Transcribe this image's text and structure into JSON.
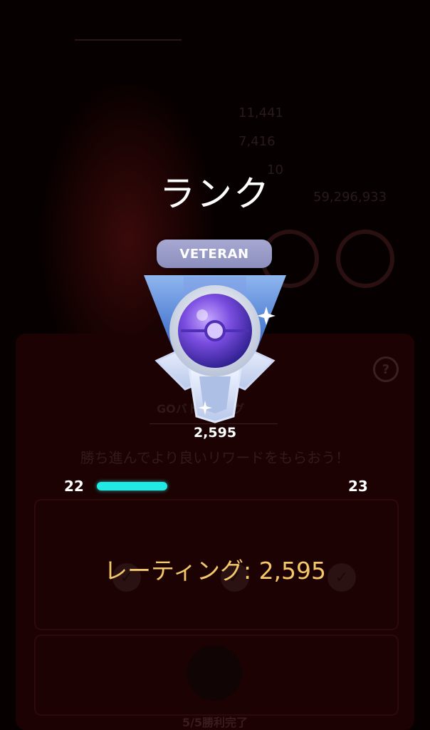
{
  "overlay": {
    "title": "ランク",
    "rank_badge_label": "VETERAN",
    "rating_score": "2,595",
    "level_current": "22",
    "level_next": "23",
    "progress_fraction": 0.3,
    "rating_text": "レーティング: 2,595"
  },
  "background": {
    "stat_lines": [
      "11,441",
      "7,416",
      "10",
      "59,296,933"
    ],
    "panel_label": "GOバトルリーグ",
    "panel_subtitle": "勝ち進んでより良いリワードをもらおう！",
    "footer_text": "5/5勝利完了",
    "help_icon": "?"
  },
  "colors": {
    "progress": "#22e9e3",
    "rating_text": "#f3c76a",
    "badge_pill": "#9c9ecb"
  }
}
